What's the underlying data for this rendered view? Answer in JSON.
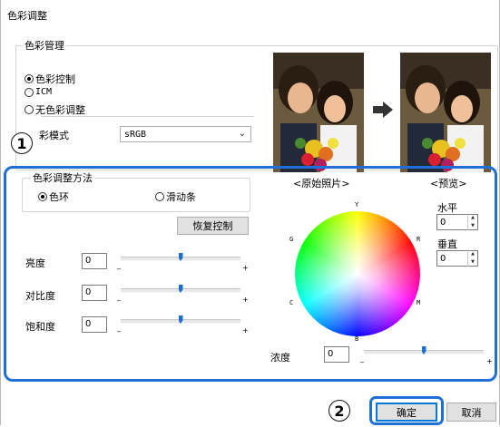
{
  "dialog": {
    "title": "色彩调整"
  },
  "color_management": {
    "legend": "色彩管理",
    "options": [
      {
        "label": "色彩控制",
        "selected": true
      },
      {
        "label": "ICM",
        "selected": false
      },
      {
        "label": "无色彩调整",
        "selected": false
      }
    ],
    "mode_label": "彩模式",
    "mode_value": "sRGB"
  },
  "method": {
    "legend": "色彩调整方法",
    "options": [
      {
        "label": "色环",
        "selected": true
      },
      {
        "label": "滑动条",
        "selected": false
      }
    ],
    "reset_label": "恢复控制"
  },
  "sliders": [
    {
      "label": "亮度",
      "value": "0",
      "min_mark": "_",
      "max_mark": "+",
      "level": 0.5
    },
    {
      "label": "对比度",
      "value": "0",
      "min_mark": "_",
      "max_mark": "+",
      "level": 0.5
    },
    {
      "label": "饱和度",
      "value": "0",
      "min_mark": "_",
      "max_mark": "+",
      "level": 0.5
    }
  ],
  "preview": {
    "original_label": "<原始照片>",
    "preview_label": "<预览>"
  },
  "wheel": {
    "labels": {
      "Y": "Y",
      "R": "R",
      "M": "M",
      "B": "B",
      "C": "C",
      "G": "G"
    }
  },
  "horizontal": {
    "label": "水平",
    "value": "0"
  },
  "vertical": {
    "label": "垂直",
    "value": "0"
  },
  "density": {
    "label": "浓度",
    "value": "0",
    "min_mark": "_",
    "max_mark": "+",
    "level": 0.5
  },
  "buttons": {
    "ok": "确定",
    "cancel": "取消"
  },
  "callouts": {
    "one": "1",
    "two": "2"
  },
  "colors": {
    "accent": "#1f6fd6",
    "slider_thumb": "#1b6fd1"
  }
}
